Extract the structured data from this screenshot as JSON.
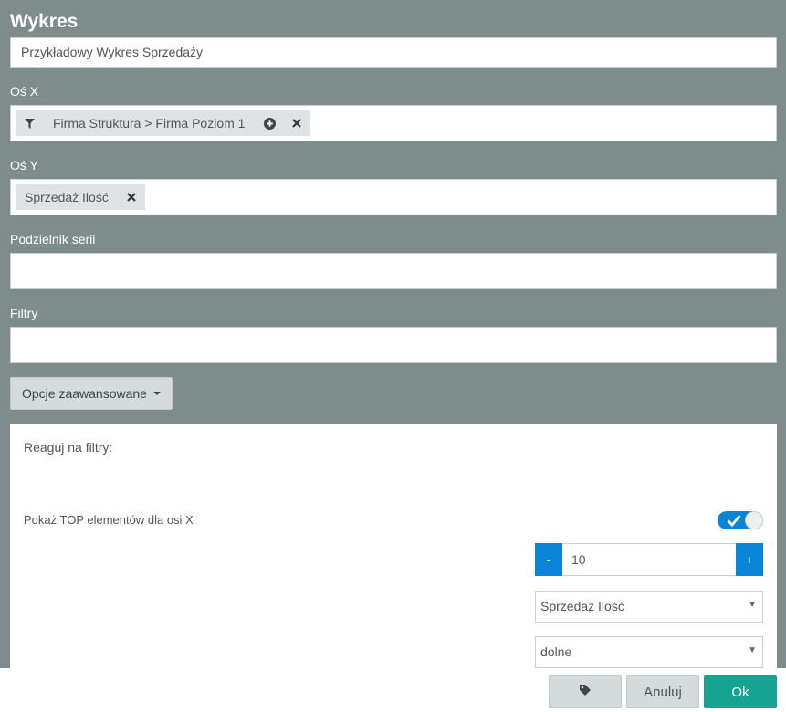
{
  "dialog": {
    "title": "Wykres"
  },
  "name_field": {
    "value": "Przykładowy Wykres Sprzedaży"
  },
  "x_axis": {
    "label": "Oś X",
    "chip_text": "Firma Struktura > Firma Poziom 1"
  },
  "y_axis": {
    "label": "Oś Y",
    "chip_text": "Sprzedaż Ilość"
  },
  "series_divider": {
    "label": "Podzielnik serii",
    "value": ""
  },
  "filters": {
    "label": "Filtry",
    "value": ""
  },
  "advanced": {
    "button_label": "Opcje zaawansowane",
    "react_filters_label": "Reaguj na filtry:",
    "top_label": "Pokaż TOP elementów dla osi X",
    "top_enabled": true,
    "stepper": {
      "minus": "-",
      "value": "10",
      "plus": "+"
    },
    "measure_select": "Sprzedaż Ilość",
    "order_select": "dolne"
  },
  "footer": {
    "cancel_label": "Anuluj",
    "ok_label": "Ok"
  },
  "colors": {
    "background": "#7f8c8c",
    "accent": "#0a84d6",
    "ok": "#17a392"
  }
}
